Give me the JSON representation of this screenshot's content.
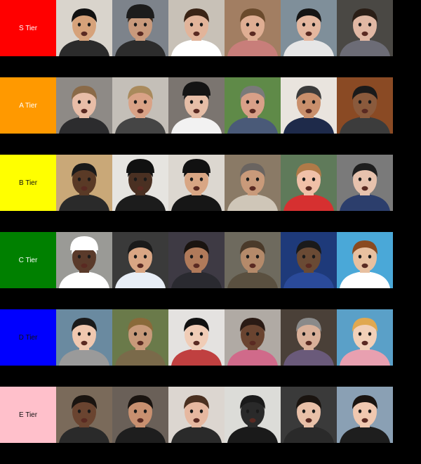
{
  "tiers": [
    {
      "label": "S Tier",
      "color": "#ff0000",
      "text_color": "#ffffff",
      "items": [
        {
          "bg": "#d9d4cc",
          "skin": "#d6a27a",
          "hair": "#111111",
          "shirt": "#2b2b2b",
          "hat": ""
        },
        {
          "bg": "#7d838b",
          "skin": "#c99a7c",
          "hair": "#3a2a1e",
          "shirt": "#2c2c2c",
          "hat": "#1c1c1c"
        },
        {
          "bg": "#c8c1b7",
          "skin": "#e2b49a",
          "hair": "#3a2416",
          "shirt": "#ffffff",
          "hat": ""
        },
        {
          "bg": "#a27e62",
          "skin": "#dfae93",
          "hair": "#6a4a2c",
          "shirt": "#c87e7a",
          "hat": ""
        },
        {
          "bg": "#7f8f9a",
          "skin": "#e4b79f",
          "hair": "#151515",
          "shirt": "#e6e6e6",
          "hat": ""
        },
        {
          "bg": "#4a4844",
          "skin": "#e1b8a4",
          "hair": "#2a1e16",
          "shirt": "#6c6c76",
          "hat": ""
        }
      ]
    },
    {
      "label": "A Tier",
      "color": "#ff9900",
      "text_color": "#ffffff",
      "items": [
        {
          "bg": "#8e8a86",
          "skin": "#e8bda7",
          "hair": "#8a6a48",
          "shirt": "#2c2c2e",
          "hat": ""
        },
        {
          "bg": "#c4bfb8",
          "skin": "#d9a286",
          "hair": "#a98a5c",
          "shirt": "#454545",
          "hat": ""
        },
        {
          "bg": "#7b7570",
          "skin": "#e6bea7",
          "hair": "#1e1e1e",
          "shirt": "#f2f2f2",
          "hat": "#141414"
        },
        {
          "bg": "#5f8a48",
          "skin": "#d8a088",
          "hair": "#7a7a7a",
          "shirt": "#4a5a78",
          "hat": ""
        },
        {
          "bg": "#e9e4de",
          "skin": "#c98f6c",
          "hair": "#3a3a3a",
          "shirt": "#1e2a4a",
          "hat": ""
        },
        {
          "bg": "#8a4a24",
          "skin": "#8a5a3c",
          "hair": "#1a1a1a",
          "shirt": "#3c3c3c",
          "hat": ""
        }
      ]
    },
    {
      "label": "B Tier",
      "color": "#ffff00",
      "text_color": "#111111",
      "items": [
        {
          "bg": "#c9a878",
          "skin": "#5a3a26",
          "hair": "#1a1a1a",
          "shirt": "#2a2a2a",
          "hat": ""
        },
        {
          "bg": "#e6e4e0",
          "skin": "#4a3022",
          "hair": "#111111",
          "shirt": "#1c1c1c",
          "hat": "#111111"
        },
        {
          "bg": "#dcd7d0",
          "skin": "#d8a684",
          "hair": "#111111",
          "shirt": "#161616",
          "hat": "#111111"
        },
        {
          "bg": "#8a7a66",
          "skin": "#c99a7a",
          "hair": "#6a6460",
          "shirt": "#cfc6b8",
          "hat": ""
        },
        {
          "bg": "#5f7a5a",
          "skin": "#f0c0a8",
          "hair": "#b07a48",
          "shirt": "#d63030",
          "hat": ""
        },
        {
          "bg": "#7a7a7a",
          "skin": "#e7c2ad",
          "hair": "#1e1e1e",
          "shirt": "#2c3e6c",
          "hat": ""
        }
      ]
    },
    {
      "label": "C Tier",
      "color": "#008000",
      "text_color": "#ffffff",
      "items": [
        {
          "bg": "#9a9a96",
          "skin": "#5a3a2a",
          "hair": "#ffffff",
          "shirt": "#ffffff",
          "hat": "#ffffff"
        },
        {
          "bg": "#3a3a3a",
          "skin": "#d9a684",
          "hair": "#1a1a1a",
          "shirt": "#e8eef6",
          "hat": ""
        },
        {
          "bg": "#3e3a44",
          "skin": "#b07a5a",
          "hair": "#1a1410",
          "shirt": "#2a2a30",
          "hat": ""
        },
        {
          "bg": "#6e6a5e",
          "skin": "#b48a6a",
          "hair": "#4a3a2a",
          "shirt": "#5a5040",
          "hat": ""
        },
        {
          "bg": "#1e3a7a",
          "skin": "#6a4a34",
          "hair": "#1a1a1a",
          "shirt": "#2a4a9a",
          "hat": ""
        },
        {
          "bg": "#4aa8d8",
          "skin": "#e8c0a0",
          "hair": "#8a4a20",
          "shirt": "#ffffff",
          "hat": ""
        }
      ]
    },
    {
      "label": "D Tier",
      "color": "#0000ff",
      "text_color": "#111111",
      "items": [
        {
          "bg": "#6a8aa0",
          "skin": "#f0c8b0",
          "hair": "#1a1a1a",
          "shirt": "#9a9a9a",
          "hat": ""
        },
        {
          "bg": "#6a7a4a",
          "skin": "#c89a7a",
          "hair": "#8a6a3a",
          "shirt": "#7a6a4a",
          "hat": ""
        },
        {
          "bg": "#e4e2e0",
          "skin": "#f0ccb6",
          "hair": "#111111",
          "shirt": "#c04040",
          "hat": ""
        },
        {
          "bg": "#b0aaa4",
          "skin": "#6a4430",
          "hair": "#2a1a14",
          "shirt": "#d06a8a",
          "hat": ""
        },
        {
          "bg": "#4a4038",
          "skin": "#d9b099",
          "hair": "#8a8a8a",
          "shirt": "#6a5a7a",
          "hat": ""
        },
        {
          "bg": "#5aa0c8",
          "skin": "#f2d0b8",
          "hair": "#e0a850",
          "shirt": "#e8a0b0",
          "hat": ""
        }
      ]
    },
    {
      "label": "E Tier",
      "color": "#ffc0cb",
      "text_color": "#111111",
      "items": [
        {
          "bg": "#7a6a5a",
          "skin": "#6a4430",
          "hair": "#1a1410",
          "shirt": "#2a2a2a",
          "hat": ""
        },
        {
          "bg": "#6a6058",
          "skin": "#c89070",
          "hair": "#1a1410",
          "shirt": "#1e1e1e",
          "hat": ""
        },
        {
          "bg": "#dcd6d0",
          "skin": "#e6b8a0",
          "hair": "#4a3020",
          "shirt": "#2a2a2a",
          "hat": ""
        },
        {
          "bg": "#dcdcd8",
          "skin": "#2a2a2a",
          "hair": "#1a1a1a",
          "shirt": "#1a1a1a",
          "hat": ""
        },
        {
          "bg": "#3a3a3a",
          "skin": "#e8c0a8",
          "hair": "#1a1410",
          "shirt": "#2a2a2a",
          "hat": ""
        },
        {
          "bg": "#8aa0b4",
          "skin": "#f0c8b0",
          "hair": "#1a1410",
          "shirt": "#1e1e1e",
          "hat": ""
        }
      ]
    }
  ]
}
